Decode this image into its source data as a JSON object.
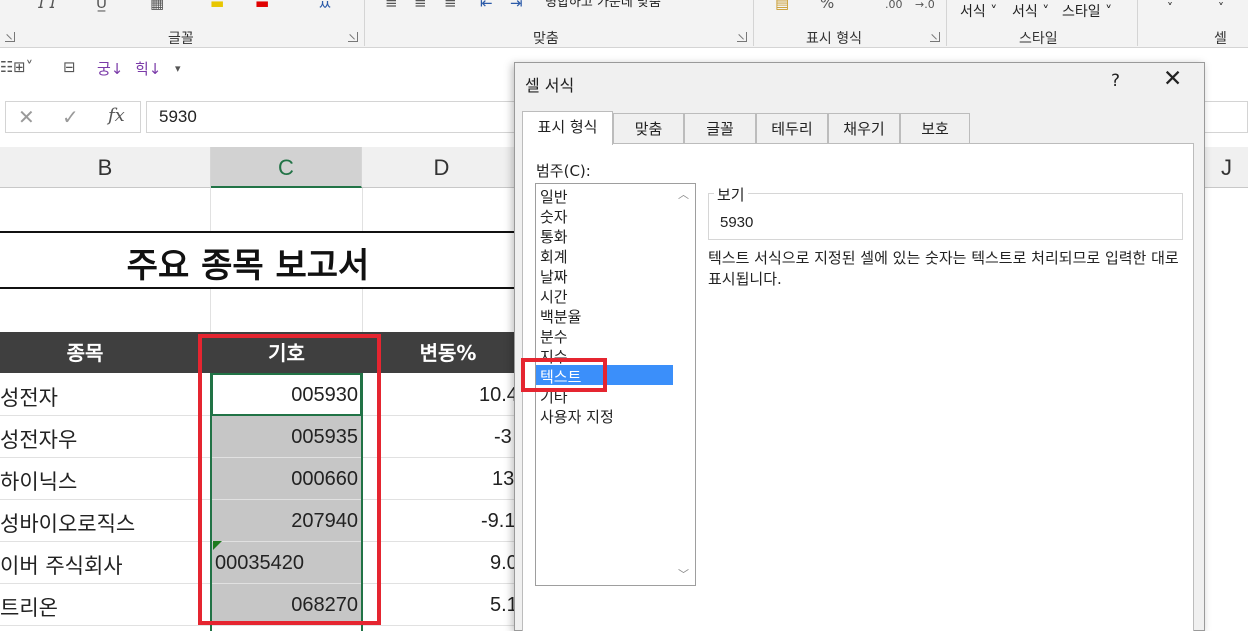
{
  "ribbon": {
    "groups": [
      {
        "label": "글꼴"
      },
      {
        "label": "맞춤"
      },
      {
        "label": "표시 형식"
      },
      {
        "label": "스타일"
      },
      {
        "label": "셀"
      }
    ],
    "style_buttons": [
      "서식 ˅",
      "서식 ˅",
      "스타일 ˅"
    ],
    "percent_glyph": "%",
    "merge_label": "병합하고 가운데 맞춤"
  },
  "formula_bar": {
    "cancel": "✕",
    "enter": "✓",
    "fx": "fx",
    "value": "5930"
  },
  "columns": [
    {
      "label": "B",
      "selected": false
    },
    {
      "label": "C",
      "selected": true
    },
    {
      "label": "D",
      "selected": false
    },
    {
      "label": "J",
      "selected": false
    }
  ],
  "sheet": {
    "title": "주요 종목 보고서",
    "headers": {
      "name": "종목",
      "code": "기호",
      "change": "변동%"
    },
    "rows": [
      {
        "name": "성전자",
        "code": "005930",
        "change": "10.4"
      },
      {
        "name": "성전자우",
        "code": "005935",
        "change": "-3"
      },
      {
        "name": "하이닉스",
        "code": "000660",
        "change": "13"
      },
      {
        "name": "성바이오로직스",
        "code": "207940",
        "change": "-9.1"
      },
      {
        "name": "이버 주식회사",
        "code": "00035420",
        "change": "9.0"
      },
      {
        "name": "트리온",
        "code": "068270",
        "change": "5.1"
      }
    ]
  },
  "dialog": {
    "title": "셀 서식",
    "help": "?",
    "close": "✕",
    "tabs": [
      "표시 형식",
      "맞춤",
      "글꼴",
      "테두리",
      "채우기",
      "보호"
    ],
    "active_tab": "표시 형식",
    "category_label": "범주(C):",
    "categories": [
      "일반",
      "숫자",
      "통화",
      "회계",
      "날짜",
      "시간",
      "백분율",
      "분수",
      "지수",
      "텍스트",
      "기타",
      "사용자 지정"
    ],
    "selected_category": "텍스트",
    "preview_label": "보기",
    "preview_value": "5930",
    "description": "텍스트 서식으로 지정된 셀에 있는 숫자는 텍스트로 처리되므로 입력한 대로 표시됩니다."
  },
  "colors": {
    "accent_green": "#217346",
    "highlight_red": "#e52530",
    "selection_blue": "#3b8ffa",
    "header_dark": "#3f3f3f"
  }
}
